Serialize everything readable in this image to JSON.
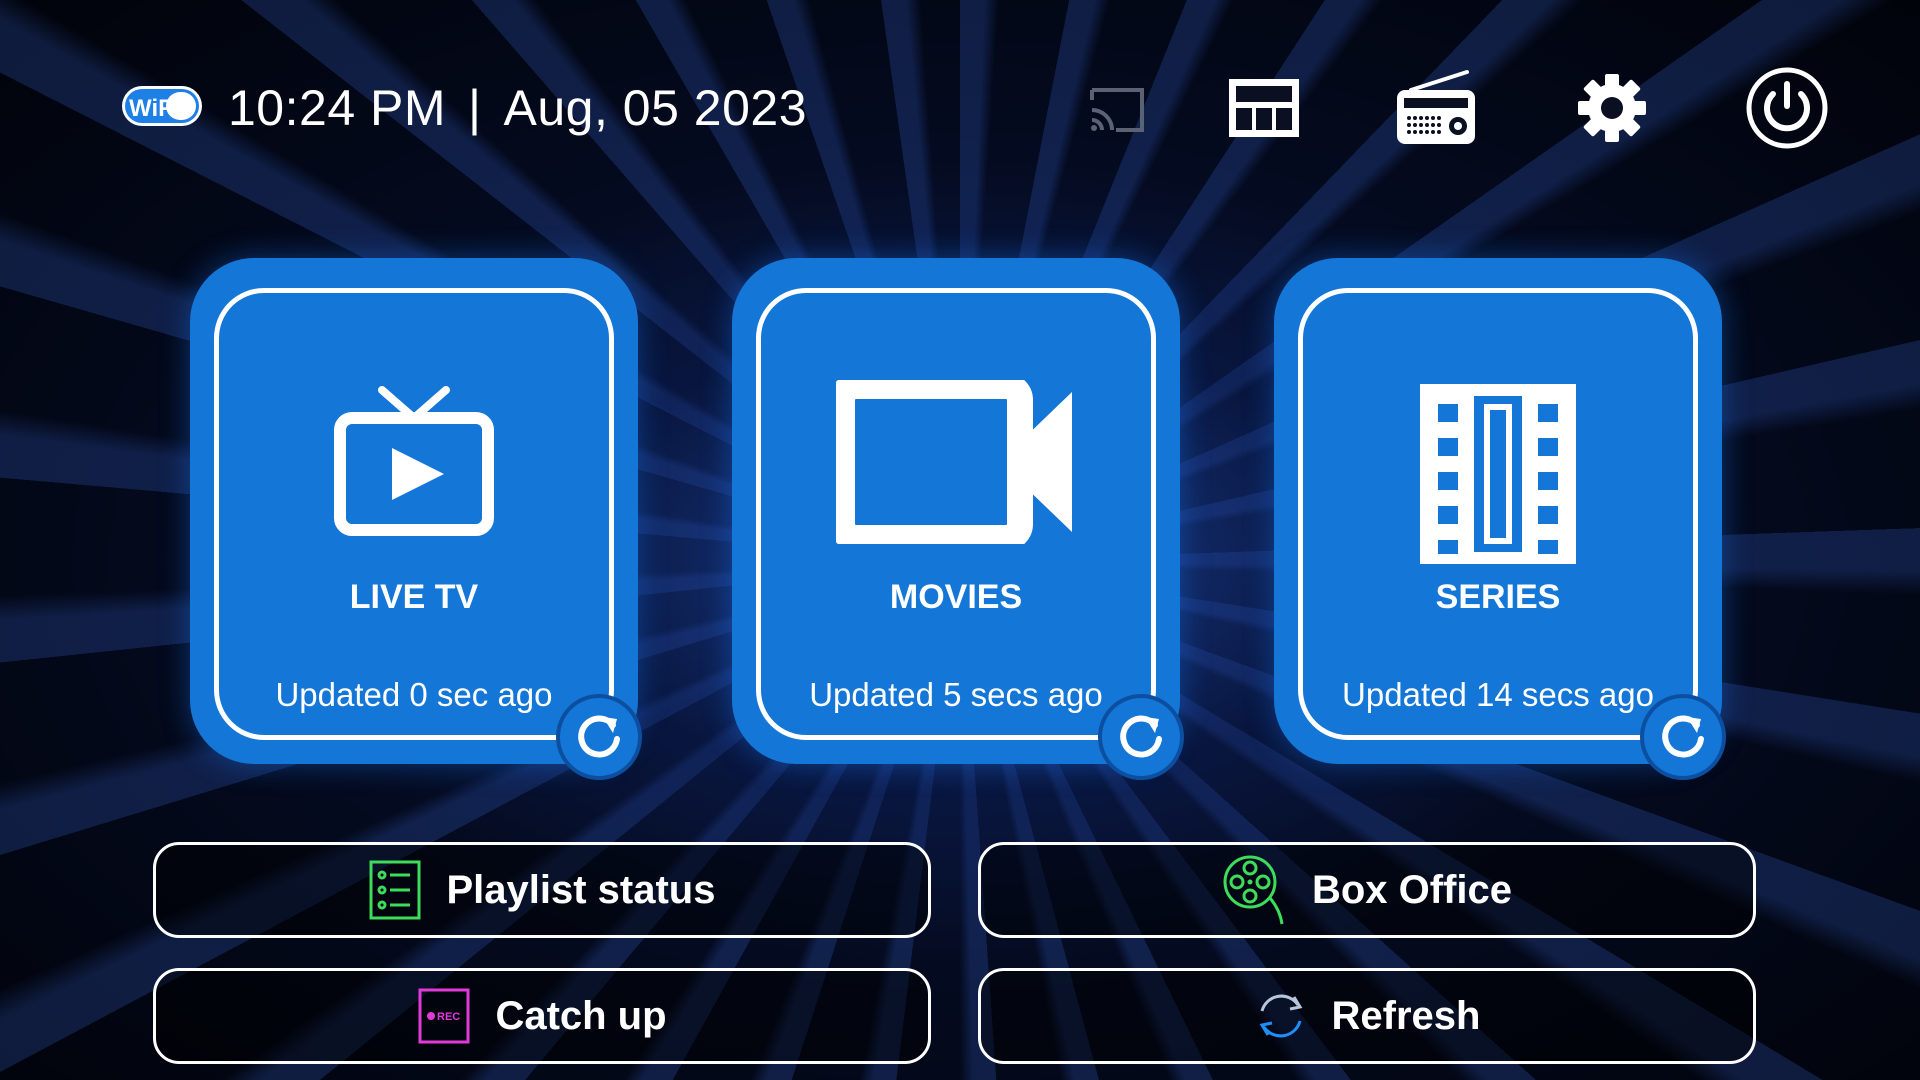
{
  "status_bar": {
    "wifi_text": "WiFi",
    "time": "10:24 PM",
    "separator": "|",
    "date": "Aug, 05 2023"
  },
  "toolbar": {
    "icons": [
      "cast-icon",
      "multiscreen-icon",
      "radio-icon",
      "gear-icon",
      "power-icon"
    ]
  },
  "categories": [
    {
      "title": "LIVE TV",
      "updated": "Updated 0 sec ago",
      "icon": "tv-play-icon"
    },
    {
      "title": "MOVIES",
      "updated": "Updated 5 secs ago",
      "icon": "video-camera-icon"
    },
    {
      "title": "SERIES",
      "updated": "Updated 14 secs ago",
      "icon": "film-strip-icon"
    }
  ],
  "actions": {
    "playlist_status": "Playlist status",
    "box_office": "Box Office",
    "catch_up": "Catch up",
    "refresh": "Refresh",
    "rec_badge": "REC"
  },
  "colors": {
    "card_blue": "#1476d6",
    "accent_green": "#3ddc5a",
    "accent_magenta": "#e23ad8",
    "background": "#02050f"
  }
}
